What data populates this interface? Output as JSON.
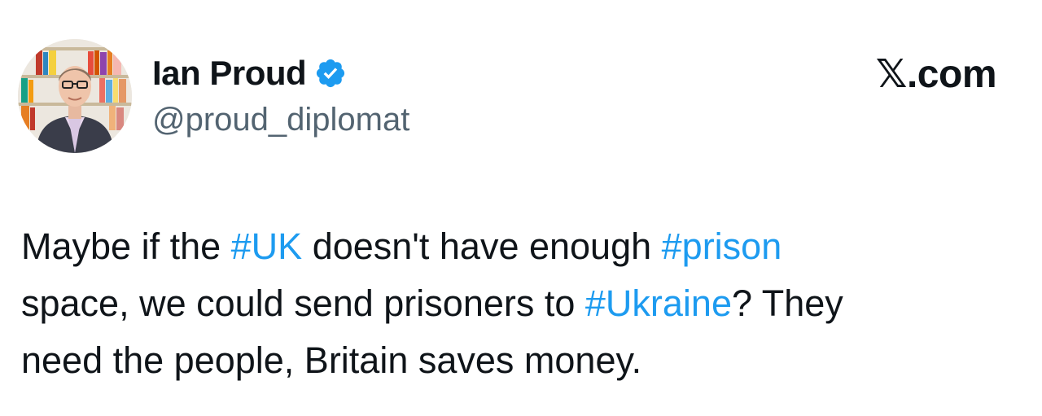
{
  "author": {
    "name": "Ian Proud",
    "handle": "@proud_diplomat",
    "verified_icon": "verified-badge-icon",
    "avatar": "profile-photo"
  },
  "source": {
    "label": "𝕏.com"
  },
  "tweet": {
    "line1": {
      "t1": "Maybe if the ",
      "h1": "#UK",
      "t2": " doesn't have enough ",
      "h2": "#prison"
    },
    "line2": {
      "t1": "space, we could send prisoners to ",
      "h1": "#Ukraine",
      "t2": "? They"
    },
    "line3": {
      "t1": "need the people, Britain saves money."
    }
  },
  "colors": {
    "text": "#0f1419",
    "secondary": "#536471",
    "hashtag": "#1d9bf0",
    "verified": "#1d9bf0"
  }
}
